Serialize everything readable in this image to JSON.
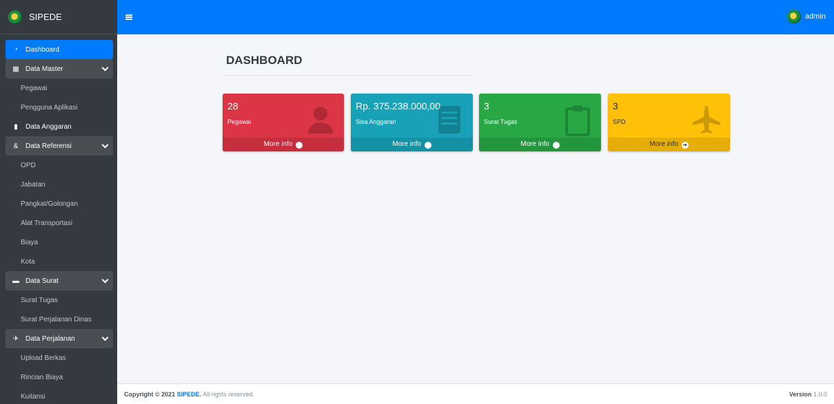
{
  "brand": {
    "name": "SIPEDE",
    "logo_icon": "brand-logo-icon"
  },
  "header": {
    "user": "admin"
  },
  "sidebar": {
    "dashboard": "Dashboard",
    "data_master": "Data Master",
    "pegawai": "Pegawai",
    "pengguna_aplikasi": "Pengguna Aplikasi",
    "data_anggaran": "Data Anggaran",
    "data_referensi": "Data Referensi",
    "opd": "OPD",
    "jabatan": "Jabatan",
    "pangkat": "Pangkat/Golongan",
    "alat_transportasi": "Alat Transportasi",
    "biaya": "Biaya",
    "kota": "Kota",
    "data_surat": "Data Surat",
    "surat_tugas": "Surat Tugas",
    "surat_perjalanan": "Surat Perjalanan Dinas",
    "data_perjalanan": "Data Perjalanan",
    "upload_berkas": "Upload Berkas",
    "rincian_biaya": "Rincian Biaya",
    "kuitansi": "Kuitansi"
  },
  "main": {
    "title": "DASHBOARD",
    "boxes": [
      {
        "value": "28",
        "label": "Pegawai",
        "footer": "More info",
        "icon": "user-icon",
        "color": "#dc3545"
      },
      {
        "value": "Rp. 375.238.000,00",
        "label": "Sisa Anggaran",
        "footer": "More info",
        "icon": "book-icon",
        "color": "#17a2b8"
      },
      {
        "value": "3",
        "label": "Surat Tugas",
        "footer": "More info",
        "icon": "clipboard-icon",
        "color": "#28a745"
      },
      {
        "value": "3",
        "label": "SPD",
        "footer": "More info",
        "icon": "plane-icon",
        "color": "#ffc107"
      }
    ]
  },
  "footer": {
    "copyright_prefix": "Copyright © 2021",
    "brand": "SIPEDE.",
    "rights": "All rights reserved.",
    "version_label": "Version",
    "version_value": "1.0.0"
  }
}
